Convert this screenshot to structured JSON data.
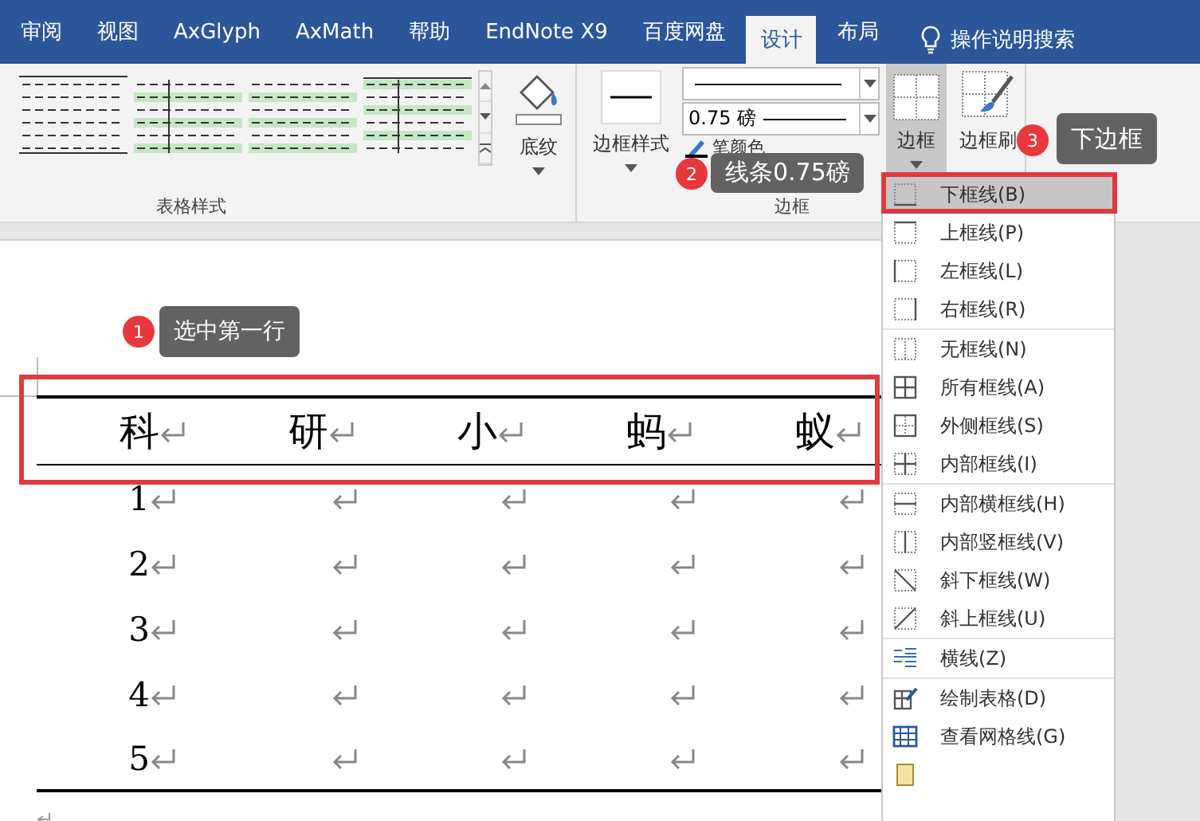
{
  "tabs": [
    {
      "label": "审阅",
      "selected": false
    },
    {
      "label": "视图",
      "selected": false
    },
    {
      "label": "AxGlyph",
      "selected": false
    },
    {
      "label": "AxMath",
      "selected": false
    },
    {
      "label": "帮助",
      "selected": false
    },
    {
      "label": "EndNote X9",
      "selected": false
    },
    {
      "label": "百度网盘",
      "selected": false
    },
    {
      "label": "设计",
      "selected": true
    },
    {
      "label": "布局",
      "selected": false
    }
  ],
  "search": {
    "label": "操作说明搜索"
  },
  "table_styles": {
    "label": "表格样式",
    "styles": [
      {
        "kind": "plain"
      },
      {
        "kind": "banded-column"
      },
      {
        "kind": "banded"
      },
      {
        "kind": "banded-header"
      }
    ]
  },
  "shading": {
    "label": "底纹"
  },
  "border_styles": {
    "label": "边框样式"
  },
  "line_weight": {
    "value": "0.75 磅"
  },
  "pen_color": {
    "label": "笔颜色"
  },
  "borders_group": {
    "label": "边框"
  },
  "borders_button": {
    "label": "边框",
    "expanded": true
  },
  "border_painter": {
    "label": "边框刷"
  },
  "border_menu": {
    "sections": [
      [
        {
          "label": "下框线(B)",
          "kind": "bottom",
          "selected": true
        },
        {
          "label": "上框线(P)",
          "kind": "top",
          "selected": false
        },
        {
          "label": "左框线(L)",
          "kind": "left",
          "selected": false
        },
        {
          "label": "右框线(R)",
          "kind": "right",
          "selected": false
        }
      ],
      [
        {
          "label": "无框线(N)",
          "kind": "none",
          "selected": false
        },
        {
          "label": "所有框线(A)",
          "kind": "all",
          "selected": false
        },
        {
          "label": "外侧框线(S)",
          "kind": "outside",
          "selected": false
        },
        {
          "label": "内部框线(I)",
          "kind": "inside",
          "selected": false
        }
      ],
      [
        {
          "label": "内部横框线(H)",
          "kind": "inside-h",
          "selected": false
        },
        {
          "label": "内部竖框线(V)",
          "kind": "inside-v",
          "selected": false
        },
        {
          "label": "斜下框线(W)",
          "kind": "diag-down",
          "selected": false
        },
        {
          "label": "斜上框线(U)",
          "kind": "diag-up",
          "selected": false
        }
      ],
      [
        {
          "label": "横线(Z)",
          "kind": "hline",
          "selected": false
        }
      ],
      [
        {
          "label": "绘制表格(D)",
          "kind": "draw",
          "selected": false
        },
        {
          "label": "查看网格线(G)",
          "kind": "grid",
          "selected": false
        },
        {
          "kind": "dialog",
          "selected": false
        }
      ]
    ]
  },
  "table": {
    "header": [
      "科",
      "研",
      "小",
      "蚂",
      "蚁"
    ],
    "rows": [
      [
        "1"
      ],
      [
        "2"
      ],
      [
        "3"
      ],
      [
        "4"
      ],
      [
        "5"
      ]
    ]
  },
  "annotations": [
    {
      "number": "1",
      "text": "选中第一行"
    },
    {
      "number": "2",
      "text": "线条0.75磅"
    },
    {
      "number": "3",
      "text": "下边框"
    }
  ]
}
